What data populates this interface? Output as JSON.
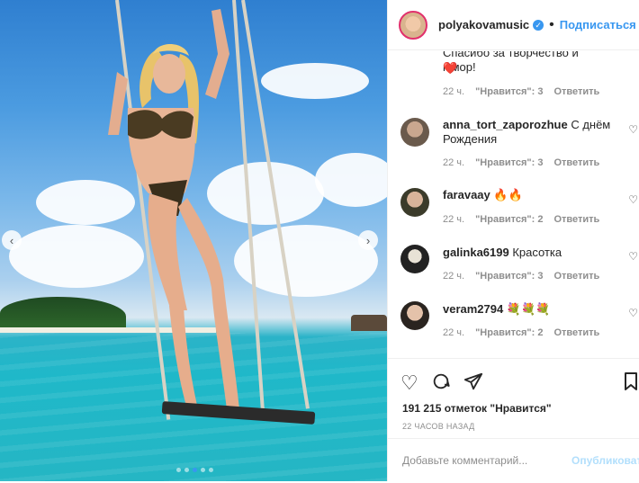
{
  "post": {
    "username": "polyakovamusic",
    "follow_label": "Подписаться",
    "separator": "•",
    "likes": "191 215 отметок \"Нравится\"",
    "time": "22 ЧАСОВ НАЗАД"
  },
  "comments": [
    {
      "user": "",
      "text": "Спасибо за творчество и юмор!",
      "emoji": "❤️",
      "time": "22 ч.",
      "likes": "\"Нравится\": 3",
      "reply": "Ответить"
    },
    {
      "user": "anna_tort_zaporozhue",
      "text": "С днём Рождения",
      "time": "22 ч.",
      "likes": "\"Нравится\": 3",
      "reply": "Ответить"
    },
    {
      "user": "faravaay",
      "text": "🔥🔥",
      "time": "22 ч.",
      "likes": "\"Нравится\": 2",
      "reply": "Ответить"
    },
    {
      "user": "galinka6199",
      "text": "Красотка",
      "time": "22 ч.",
      "likes": "\"Нравится\": 3",
      "reply": "Ответить"
    },
    {
      "user": "veram2794",
      "text": "💐💐💐",
      "time": "22 ч.",
      "likes": "\"Нравится\": 2",
      "reply": "Ответить"
    }
  ],
  "add_comment": {
    "placeholder": "Добавьте комментарий...",
    "publish": "Опубликовать"
  },
  "carousel": {
    "slides": 5,
    "active": 3
  },
  "colors": {
    "accent": "#3897f0",
    "text": "#262626",
    "muted": "#8e8e8e"
  },
  "icons": [
    "heart-icon",
    "comment-icon",
    "share-icon",
    "bookmark-icon",
    "chevron-left-icon",
    "chevron-right-icon",
    "verified-icon"
  ]
}
